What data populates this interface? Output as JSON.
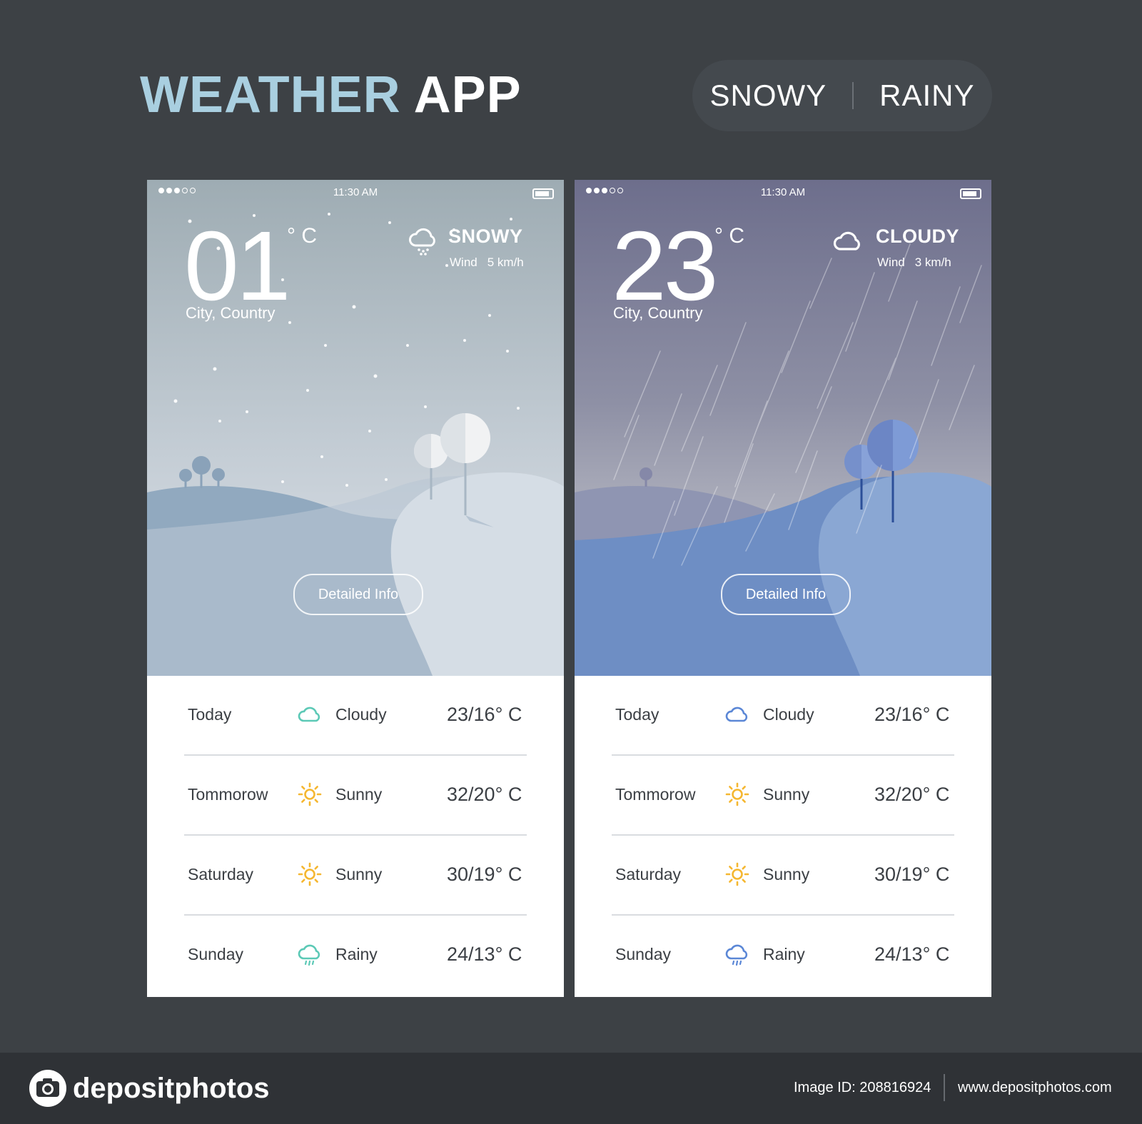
{
  "header": {
    "title_part1": "WEATHER",
    "title_part2": "APP"
  },
  "mode_switch": {
    "option1": "SNOWY",
    "option2": "RAINY"
  },
  "phones": [
    {
      "status": {
        "time": "11:30 AM"
      },
      "temperature": "01",
      "degree_unit": "° C",
      "location": "City, Country",
      "condition": "SNOWY",
      "condition_icon": "cloud-snow-icon",
      "wind_label": "Wind",
      "wind_value": "5 km/h",
      "detail_button": "Detailed Info",
      "forecast": [
        {
          "day": "Today",
          "icon": "cloud-icon",
          "condition": "Cloudy",
          "range": "23/16° C"
        },
        {
          "day": "Tommorow",
          "icon": "sun-icon",
          "condition": "Sunny",
          "range": "32/20° C"
        },
        {
          "day": "Saturday",
          "icon": "sun-icon",
          "condition": "Sunny",
          "range": "30/19° C"
        },
        {
          "day": "Sunday",
          "icon": "cloud-rain-icon",
          "condition": "Rainy",
          "range": "24/13° C"
        }
      ]
    },
    {
      "status": {
        "time": "11:30 AM"
      },
      "temperature": "23",
      "degree_unit": "° C",
      "location": "City, Country",
      "condition": "CLOUDY",
      "condition_icon": "cloud-icon",
      "wind_label": "Wind",
      "wind_value": "3 km/h",
      "detail_button": "Detailed Info",
      "forecast": [
        {
          "day": "Today",
          "icon": "cloud-icon",
          "condition": "Cloudy",
          "range": "23/16° C"
        },
        {
          "day": "Tommorow",
          "icon": "sun-icon",
          "condition": "Sunny",
          "range": "32/20° C"
        },
        {
          "day": "Saturday",
          "icon": "sun-icon",
          "condition": "Sunny",
          "range": "30/19° C"
        },
        {
          "day": "Sunday",
          "icon": "cloud-rain-icon",
          "condition": "Rainy",
          "range": "24/13° C"
        }
      ]
    }
  ],
  "colors": {
    "title_accent": "#a9cfe0",
    "snowy_icon_cloud": "#5cc9b6",
    "rainy_icon_cloud": "#5b87d6",
    "sun": "#f5b731"
  },
  "footer": {
    "logo": "depositphotos",
    "image_id": "Image ID: 208816924",
    "site": "www.depositphotos.com"
  }
}
